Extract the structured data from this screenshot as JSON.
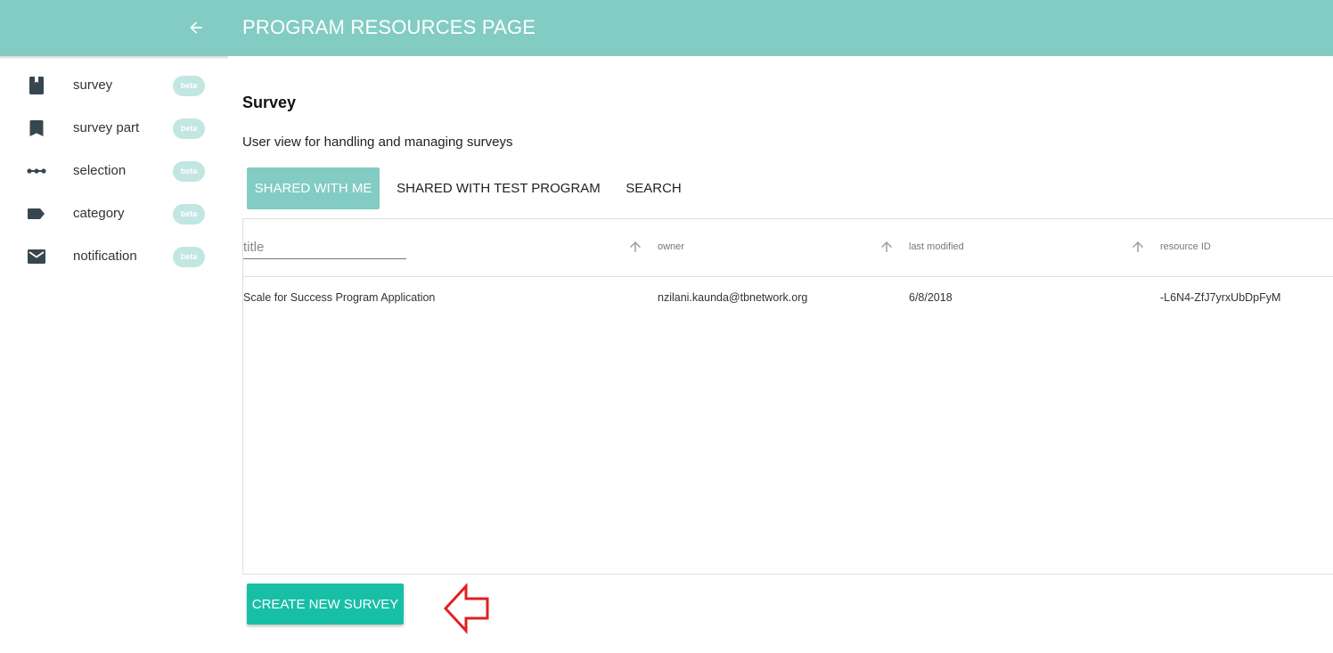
{
  "header": {
    "title": "PROGRAM RESOURCES PAGE",
    "back_icon": "arrow-left-icon",
    "color": "#82ccc4"
  },
  "sidebar": {
    "items": [
      {
        "label": "survey",
        "badge": "beta",
        "icon": "book-icon"
      },
      {
        "label": "survey part",
        "badge": "beta",
        "icon": "bookmark-icon"
      },
      {
        "label": "selection",
        "badge": "beta",
        "icon": "linear-scale-icon"
      },
      {
        "label": "category",
        "badge": "beta",
        "icon": "label-tag-icon"
      },
      {
        "label": "notification",
        "badge": "beta",
        "icon": "mail-icon"
      }
    ]
  },
  "main": {
    "title": "Survey",
    "description": "User view for handling and managing surveys",
    "tabs": [
      {
        "label": "SHARED WITH ME",
        "active": true
      },
      {
        "label": "SHARED WITH  TEST PROGRAM",
        "active": false
      },
      {
        "label": "SEARCH",
        "active": false
      }
    ],
    "table": {
      "title_placeholder": "title",
      "columns": [
        "owner",
        "last modified",
        "resource ID"
      ],
      "rows": [
        {
          "title": "Scale for Success Program Application",
          "owner": "nzilani.kaunda@tbnetwork.org",
          "last_modified": "6/8/2018",
          "resource_id": "-L6N4-ZfJ7yrxUbDpFyM"
        }
      ]
    },
    "create_button": "CREATE NEW SURVEY",
    "accent": "#17bfa6",
    "annotation_color": "#e02020"
  }
}
